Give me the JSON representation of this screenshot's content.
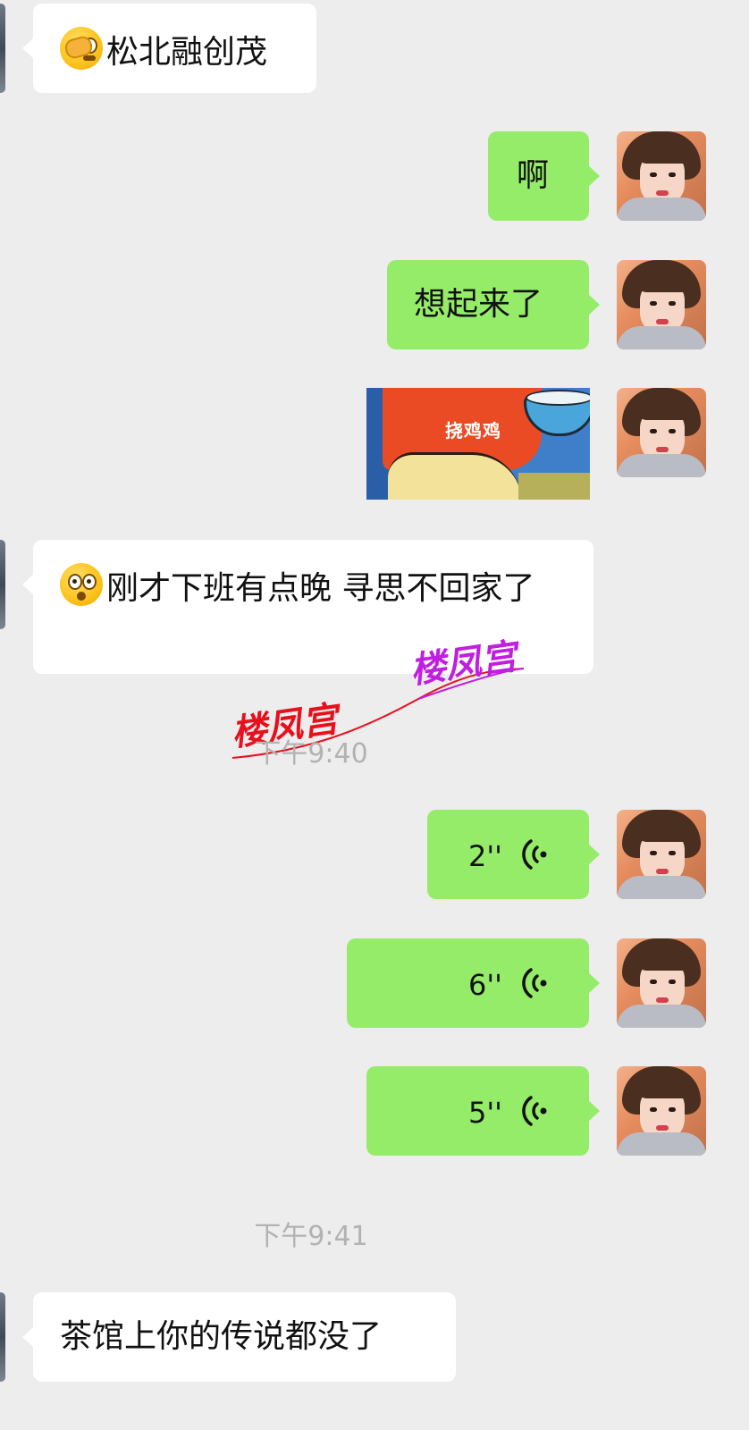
{
  "messages": [
    {
      "side": "in",
      "emoji": "facepalm-emoji",
      "text": "松北融创茂"
    },
    {
      "side": "out",
      "text": "啊"
    },
    {
      "side": "out",
      "text": "想起来了"
    },
    {
      "side": "out",
      "type": "image",
      "caption": "挠鸡鸡"
    },
    {
      "side": "in",
      "emoji": "flushed-face-emoji",
      "text": "刚才下班有点晚  寻思不回家了"
    },
    {
      "side": "out",
      "type": "voice",
      "duration": "2''"
    },
    {
      "side": "out",
      "type": "voice",
      "duration": "6''"
    },
    {
      "side": "out",
      "type": "voice",
      "duration": "5''"
    },
    {
      "side": "in",
      "text": "茶馆上你的传说都没了"
    }
  ],
  "timestamps": [
    "下午9:40",
    "下午9:41"
  ],
  "watermark": {
    "red": "楼凤宫",
    "purple": "楼凤宫"
  },
  "colors": {
    "background": "#ededed",
    "incoming_bubble": "#ffffff",
    "outgoing_bubble": "#95ec69",
    "timestamp": "#b2b2b2"
  }
}
